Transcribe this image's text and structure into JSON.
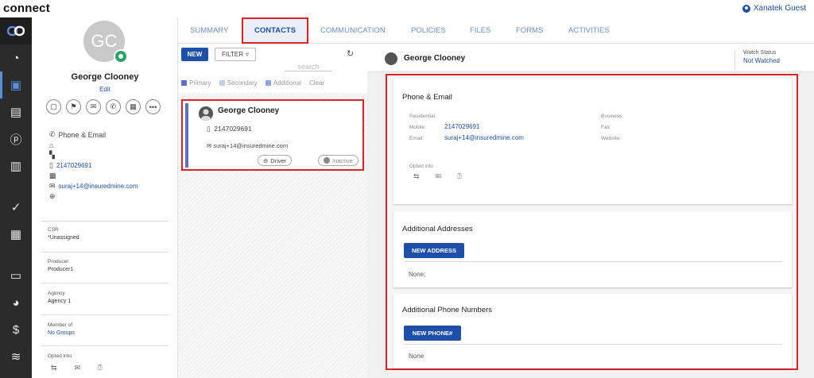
{
  "app": {
    "title": "connect",
    "user_name": "Xanatek Guest"
  },
  "rail": {
    "icons": [
      "logo-link-icon",
      "dashboard-gauge-icon",
      "contacts-icon",
      "id-card-icon",
      "policy-p-icon",
      "document-icon",
      "check-icon",
      "calendar-icon",
      "archive-icon",
      "pie-chart-icon",
      "dollar-icon",
      "rss-icon"
    ],
    "active": "contacts-icon"
  },
  "profile": {
    "initials": "GC",
    "name": "George Clooney",
    "edit_label": "Edit",
    "section_title": "Phone & Email",
    "phone": "2147029691",
    "email": "suraj+14@insuredmine.com",
    "csr_label": "CSR",
    "csr_value": "*Unassigned",
    "producer_label": "Producer",
    "producer_value": "Producer1",
    "agency_label": "Agency",
    "agency_value": "Agency 1",
    "member_label": "Member of",
    "member_value": "No Groups",
    "opted_label": "Opted into"
  },
  "tabs": [
    {
      "label": "SUMMARY"
    },
    {
      "label": "CONTACTS",
      "active": true
    },
    {
      "label": "COMMUNICATION"
    },
    {
      "label": "POLICIES"
    },
    {
      "label": "FILES"
    },
    {
      "label": "FORMS"
    },
    {
      "label": "ACTIVITIES"
    }
  ],
  "list": {
    "new_label": "NEW",
    "filter_label": "FILTER",
    "search_placeholder": "search",
    "legend": [
      {
        "label": "Primary",
        "color": "#5b6fd0"
      },
      {
        "label": "Secondary",
        "color": "#c8cce8"
      },
      {
        "label": "Additional",
        "color": "#8fa6e8"
      },
      {
        "label": "Clear",
        "color": ""
      }
    ],
    "card": {
      "name": "George Clooney",
      "phone": "2147029691",
      "email": "suraj+14@insuredmine.com",
      "tag1": "Driver",
      "tag2": "Inactive"
    }
  },
  "detail": {
    "name": "George Clooney",
    "watch_label": "Watch Status",
    "watch_value": "Not Watched",
    "phone_email_title": "Phone & Email",
    "residential_label": "Residential:",
    "mobile_label": "Mobile:",
    "mobile_value": "2147029691",
    "email_label": "Email:",
    "email_value": "suraj+14@insuredmine.com",
    "business_label": "Business:",
    "fax_label": "Fax:",
    "website_label": "Website:",
    "opted_label": "Opted into",
    "addresses_title": "Additional Addresses",
    "new_address_label": "NEW ADDRESS",
    "addresses_value": "None;",
    "phones_title": "Additional Phone Numbers",
    "new_phone_label": "NEW PHONE#",
    "phones_value": "None"
  },
  "colors": {
    "brand": "#1e4fa8",
    "highlight": "#dd2222",
    "rail": "#2b2b2b"
  }
}
